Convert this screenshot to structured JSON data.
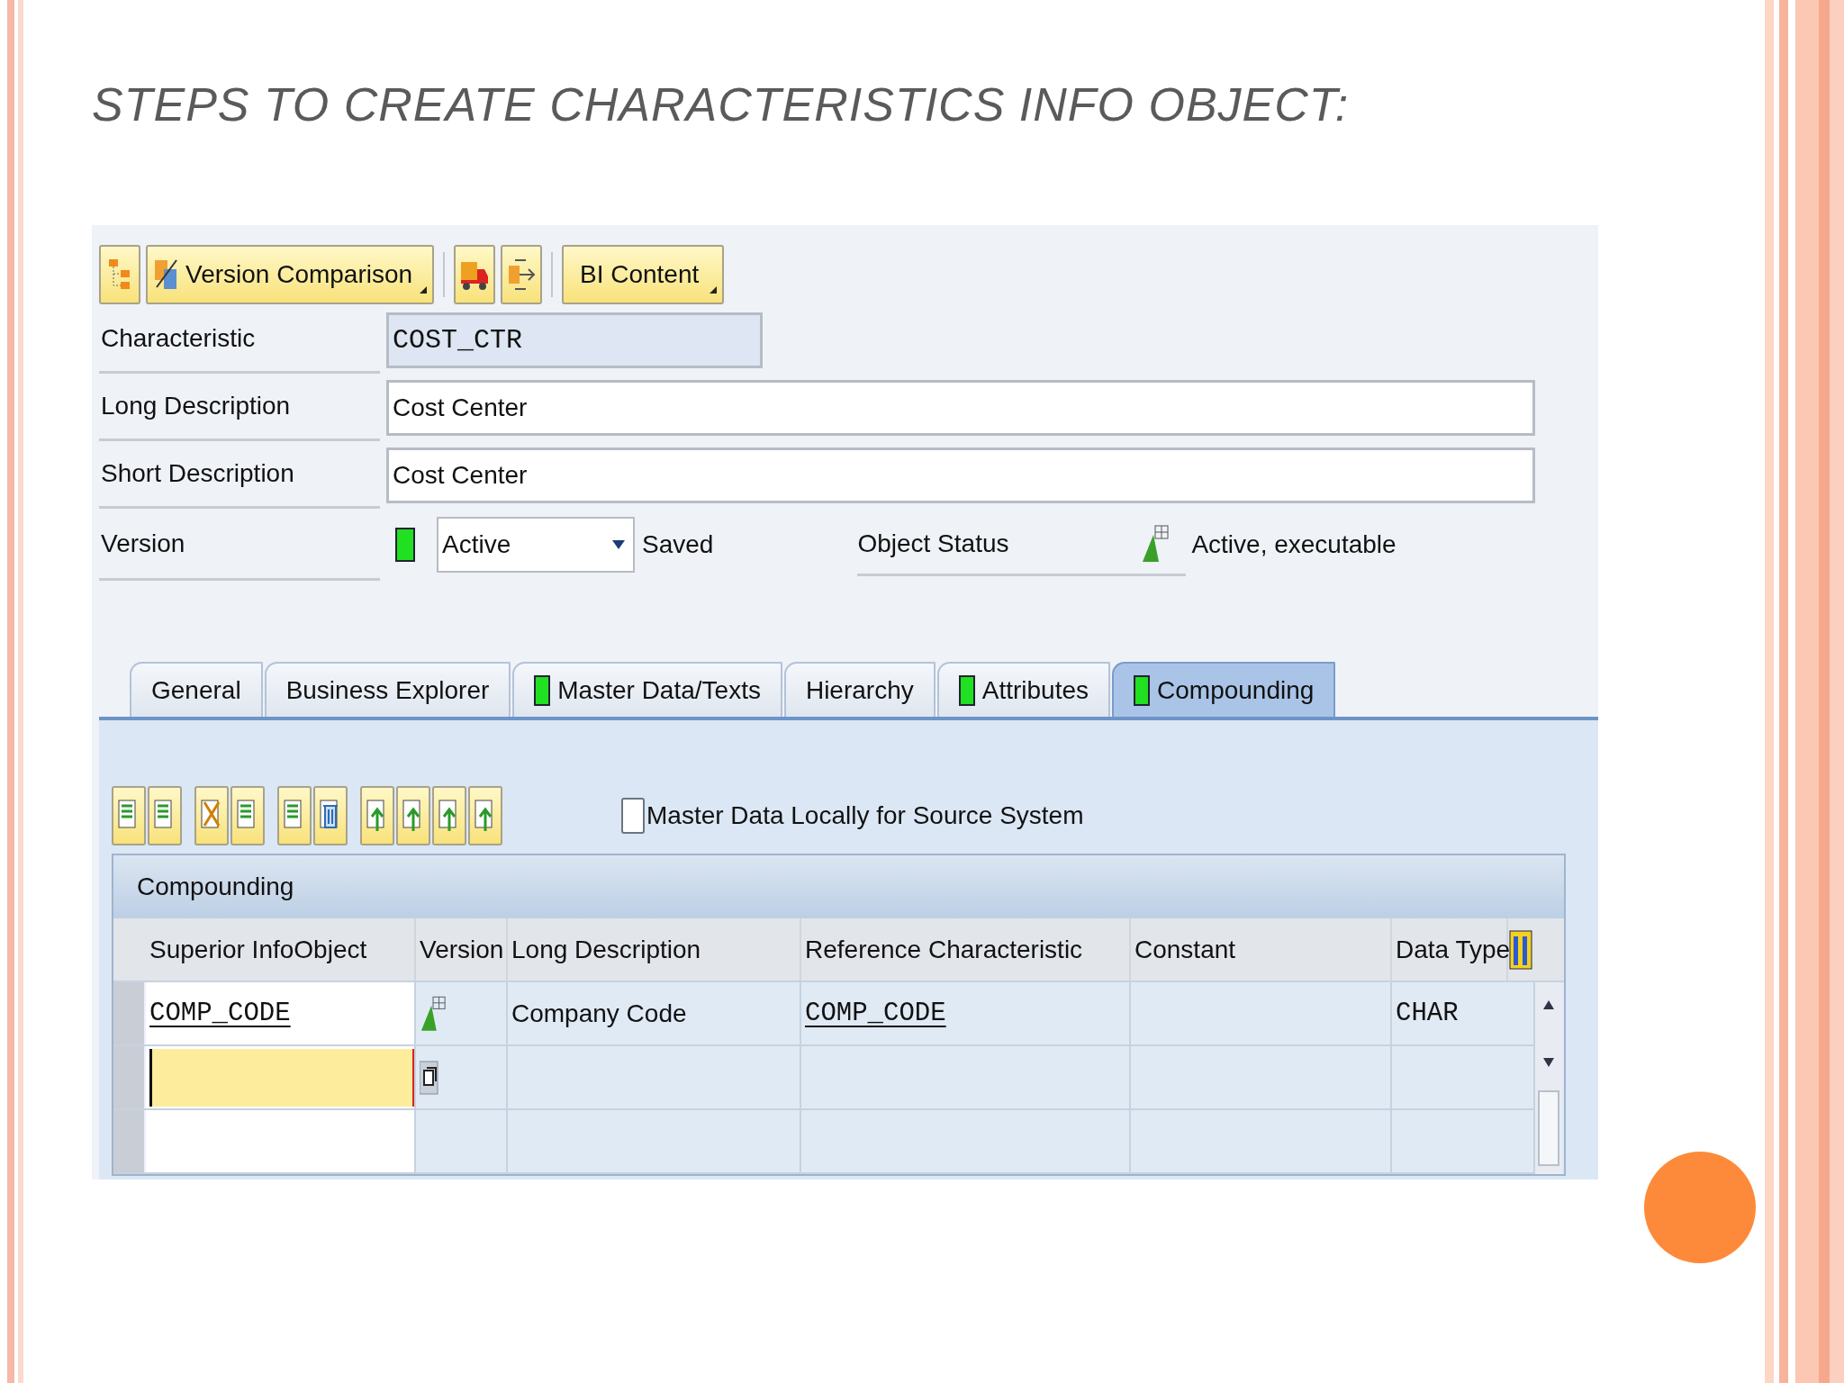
{
  "slide": {
    "title": "STEPS TO CREATE CHARACTERISTICS INFO OBJECT:"
  },
  "toolbar": {
    "buttons": [
      {
        "label": "Version Comparison"
      },
      {
        "label": "BI Content"
      }
    ]
  },
  "fields": [
    {
      "label": "Characteristic",
      "value": "COST_CTR",
      "kind": "display"
    },
    {
      "label": "Long Description",
      "value": "Cost Center",
      "kind": "input"
    },
    {
      "label": "Short Description",
      "value": "Cost Center",
      "kind": "input"
    }
  ],
  "version": {
    "label": "Version",
    "value": "Active",
    "saved": "Saved",
    "object_status_label": "Object Status",
    "object_status": "Active, executable"
  },
  "tabs": [
    {
      "label": "General",
      "selected": false,
      "indicator": false
    },
    {
      "label": "Business Explorer",
      "selected": false,
      "indicator": false
    },
    {
      "label": "Master Data/Texts",
      "selected": false,
      "indicator": true
    },
    {
      "label": "Hierarchy",
      "selected": false,
      "indicator": false
    },
    {
      "label": "Attributes",
      "selected": false,
      "indicator": true
    },
    {
      "label": "Compounding",
      "selected": true,
      "indicator": true
    }
  ],
  "checkbox": {
    "label": "Master Data Locally for Source System",
    "checked": false
  },
  "table": {
    "title": "Compounding",
    "columns": [
      "Superior InfoObject",
      "Version",
      "Long Description",
      "Reference Characteristic",
      "Constant",
      "Data Type"
    ],
    "rows": [
      {
        "superior_infoobject": "COMP_CODE",
        "long_description": "Company Code",
        "reference_characteristic": "COMP_CODE",
        "data_type": "CHAR"
      }
    ],
    "input_row": {
      "focused": true
    }
  }
}
